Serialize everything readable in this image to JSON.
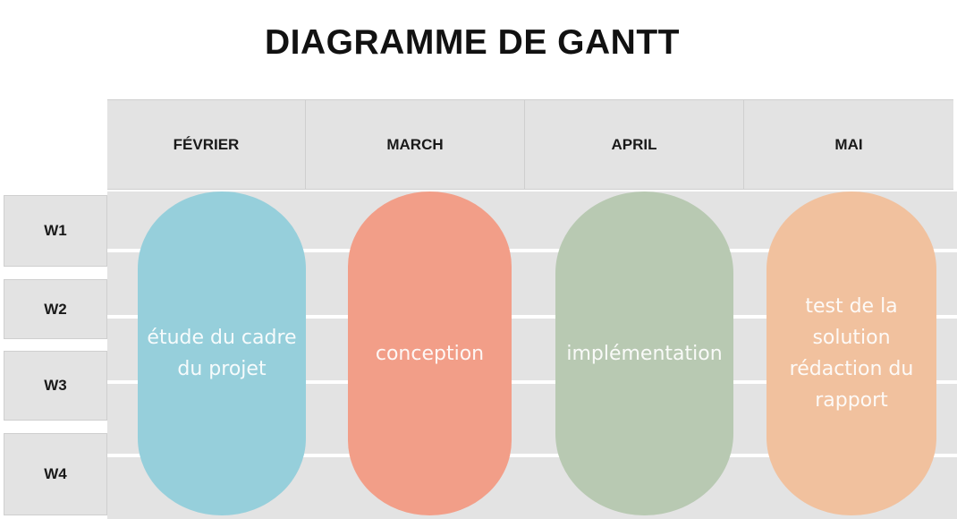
{
  "title": "DIAGRAMME DE GANTT",
  "months": [
    "FÉVRIER",
    "MARCH",
    "APRIL",
    "MAI"
  ],
  "weeks": [
    "W1",
    "W2",
    "W3",
    "W4"
  ],
  "tasks": [
    {
      "label": "étude du cadre\ndu projet",
      "color": "#96cfdb"
    },
    {
      "label": "conception",
      "color": "#f29e88"
    },
    {
      "label": "implémentation",
      "color": "#b8c9b2"
    },
    {
      "label": "test de la\nsolution\nrédaction du\nrapport",
      "color": "#f1c19e"
    }
  ]
}
